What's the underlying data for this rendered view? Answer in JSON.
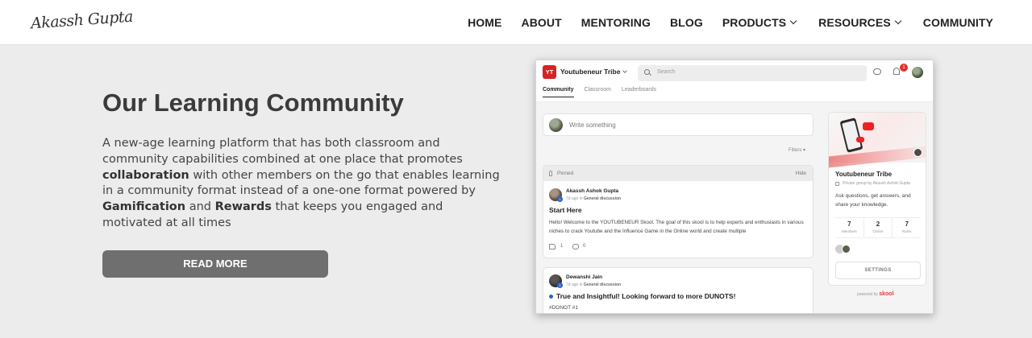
{
  "header": {
    "logo_text": "Akassh Gupta",
    "nav": [
      {
        "label": "HOME"
      },
      {
        "label": "ABOUT"
      },
      {
        "label": "MENTORING"
      },
      {
        "label": "BLOG"
      },
      {
        "label": "PRODUCTS",
        "icon": "chevron-down-icon"
      },
      {
        "label": "RESOURCES",
        "icon": "chevron-down-icon"
      },
      {
        "label": "COMMUNITY"
      }
    ]
  },
  "hero": {
    "title": "Our Learning Community",
    "body": {
      "p1": "A new-age learning platform that has both classroom and community capabilities combined at one place that promotes ",
      "b1": "collaboration",
      "p2": " with other members on the go that enables learning in a community format instead of a one-one format powered by ",
      "b2": "Gamification",
      "p3": " and ",
      "b3": "Rewards",
      "p4": " that keeps you engaged and motivated at all times"
    },
    "button_label": "READ MORE"
  },
  "mockup": {
    "group_badge": "YT",
    "group_name": "Youtubeneur Tribe",
    "search_placeholder": "Search",
    "notification_count": "1",
    "tabs": [
      "Community",
      "Classroom",
      "Leaderboards"
    ],
    "write_placeholder": "Write something",
    "filters_label": "Filters ▾",
    "pinned_label": "Pinned",
    "hide_label": "Hide",
    "posts": [
      {
        "author": "Akassh Ashok Gupta",
        "level": "1",
        "meta_time": "7d ago in ",
        "category": "General discussion",
        "title": "Start Here",
        "text": "Hello! Welcome to the YOUTUBENEUR Skool. The goal of this skool is to help experts and enthusiasts in various niches to crack Youtube and the Influence Game in the Online world and create multiple",
        "likes": "1",
        "comments": "0"
      },
      {
        "author": "Dewanshi Jain",
        "level": "1",
        "meta_time": "7d ago in ",
        "category": "General discussion",
        "title": "True and Insightful! Looking forward to more DUNOTS!",
        "tag": "#DONOT #1"
      }
    ],
    "sidebar": {
      "title": "Youtubeneur Tribe",
      "privacy": "Private group by Akassh Ashok Gupta",
      "description": "Ask questions, get answers, and share your knowledge.",
      "stats": [
        {
          "value": "7",
          "label": "Members"
        },
        {
          "value": "2",
          "label": "Online"
        },
        {
          "value": "7",
          "label": "Rules"
        }
      ],
      "settings_label": "SETTINGS"
    },
    "powered_by": "powered by ",
    "powered_brand": "skool"
  }
}
